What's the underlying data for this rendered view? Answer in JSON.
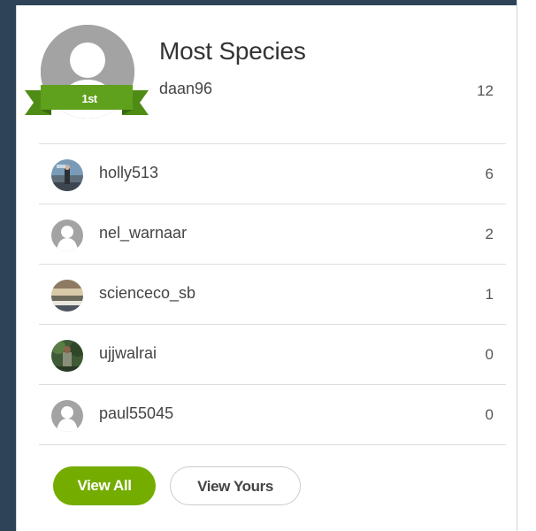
{
  "leaderboard": {
    "title": "Most Species",
    "leader": {
      "username": "daan96",
      "count": "12",
      "badge": "1st",
      "badge_color": "#5fa01d"
    },
    "rows": [
      {
        "username": "holly513",
        "count": "6",
        "avatar": "photo-person-coast"
      },
      {
        "username": "nel_warnaar",
        "count": "2",
        "avatar": "default-person-icon"
      },
      {
        "username": "scienceco_sb",
        "count": "1",
        "avatar": "photo-landscape"
      },
      {
        "username": "ujjwalrai",
        "count": "0",
        "avatar": "photo-person-forest"
      },
      {
        "username": "paul55045",
        "count": "0",
        "avatar": "default-person-icon"
      }
    ]
  },
  "buttons": {
    "view_all": "View All",
    "view_yours": "View Yours",
    "accent_color": "#74ac00"
  }
}
